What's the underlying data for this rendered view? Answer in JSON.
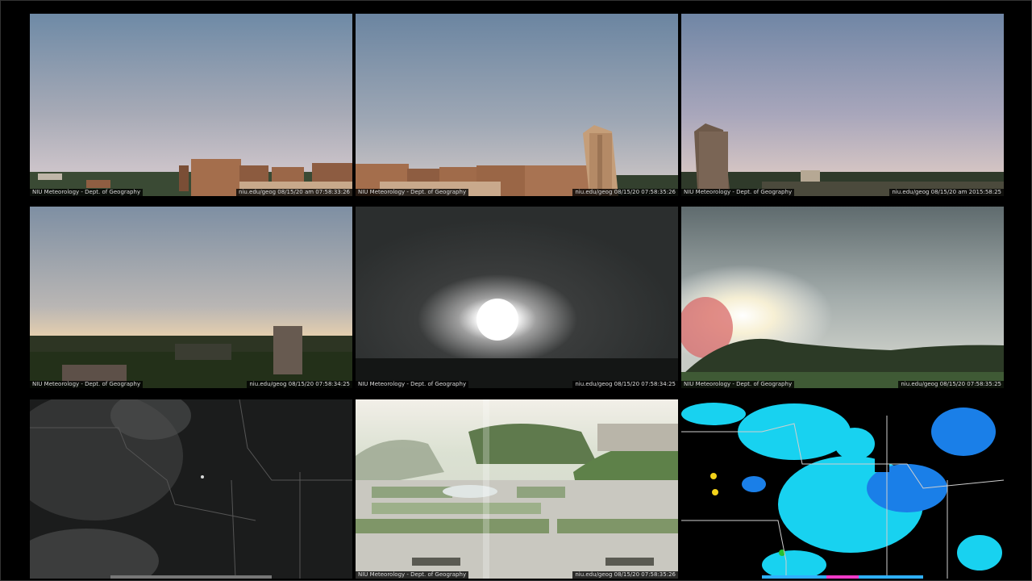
{
  "page": {
    "tiles": [
      {
        "name": "cam-north-east",
        "left_caption": "NIU Meteorology - Dept. of Geography",
        "right_caption": "niu.edu/geog  08/15/20 am 07:58:33:26"
      },
      {
        "name": "cam-south",
        "left_caption": "NIU Meteorology - Dept. of Geography",
        "right_caption": "niu.edu/geog  08/15/20 07:58:35:26"
      },
      {
        "name": "cam-south-west",
        "left_caption": "NIU Meteorology - Dept. of Geography",
        "right_caption": "niu.edu/geog  08/15/20 am 2015:58:25"
      },
      {
        "name": "cam-west",
        "left_caption": "NIU Meteorology - Dept. of Geography",
        "right_caption": "niu.edu/geog  08/15/20 07:58:34:25"
      },
      {
        "name": "cam-east-sun",
        "left_caption": "NIU Meteorology - Dept. of Geography",
        "right_caption": "niu.edu/geog  08/15/20 07:58:34:25"
      },
      {
        "name": "cam-east-trees",
        "left_caption": "NIU Meteorology - Dept. of Geography",
        "right_caption": "niu.edu/geog  08/15/20 07:58:35:25"
      },
      {
        "name": "satellite-visible",
        "left_caption": "",
        "right_caption": ""
      },
      {
        "name": "cam-plaza",
        "left_caption": "NIU Meteorology - Dept. of Geography",
        "right_caption": "niu.edu/geog  08/15/20 07:58:35:26"
      },
      {
        "name": "radar-mosaic",
        "left_caption": "",
        "right_caption": ""
      }
    ]
  },
  "colors": {
    "background": "#000000",
    "sky_top": "#6f87a3",
    "sky_horizon": "#c9c0c8",
    "brick": "#a5714f",
    "radar_cyan": "#18d2f0",
    "radar_blue": "#1a7fe8"
  }
}
